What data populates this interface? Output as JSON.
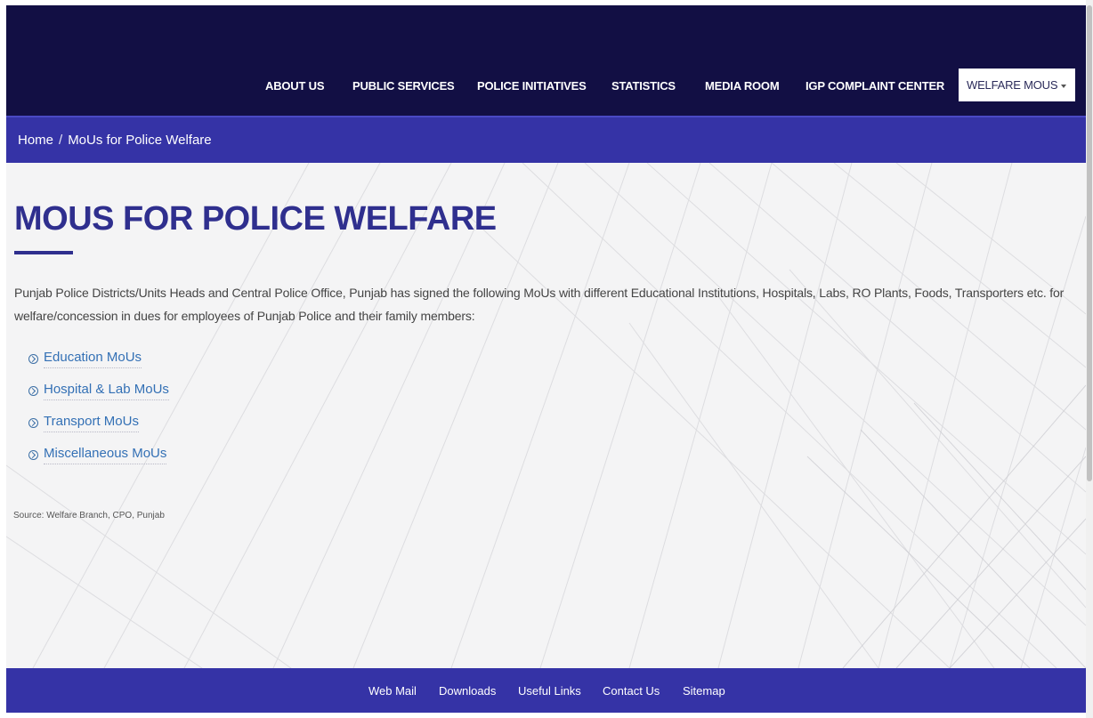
{
  "header": {
    "nav": [
      {
        "label": "ABOUT US"
      },
      {
        "label": "PUBLIC SERVICES"
      },
      {
        "label": "POLICE INITIATIVES"
      },
      {
        "label": "STATISTICS"
      },
      {
        "label": "MEDIA ROOM"
      },
      {
        "label": "IGP COMPLAINT CENTER"
      },
      {
        "label": "WELFARE MOUS",
        "active": true
      }
    ]
  },
  "breadcrumb": {
    "home": "Home",
    "separator": "/",
    "current": "MoUs for Police Welfare"
  },
  "main": {
    "title": "MOUS FOR POLICE WELFARE",
    "intro": "Punjab Police Districts/Units Heads and Central Police Office, Punjab has signed the following MoUs with different Educational Institutions, Hospitals, Labs, RO Plants, Foods, Transporters etc. for welfare/concession in dues for employees of Punjab Police and their family members:",
    "links": [
      {
        "label": "Education MoUs"
      },
      {
        "label": "Hospital & Lab MoUs"
      },
      {
        "label": "Transport MoUs"
      },
      {
        "label": "Miscellaneous MoUs"
      }
    ],
    "source": "Source: Welfare Branch, CPO, Punjab"
  },
  "footer": {
    "links": [
      {
        "label": "Web Mail"
      },
      {
        "label": "Downloads"
      },
      {
        "label": "Useful Links"
      },
      {
        "label": "Contact Us"
      },
      {
        "label": "Sitemap"
      }
    ]
  },
  "colors": {
    "header_bg": "#120f44",
    "breadcrumb_bg": "#3533a6",
    "title": "#2f2f8e",
    "link": "#3370b5",
    "footer_bg": "#3533a6"
  },
  "icons": {
    "link_bullet": "circle-chevron-right-icon",
    "dropdown": "caret-down-icon"
  }
}
